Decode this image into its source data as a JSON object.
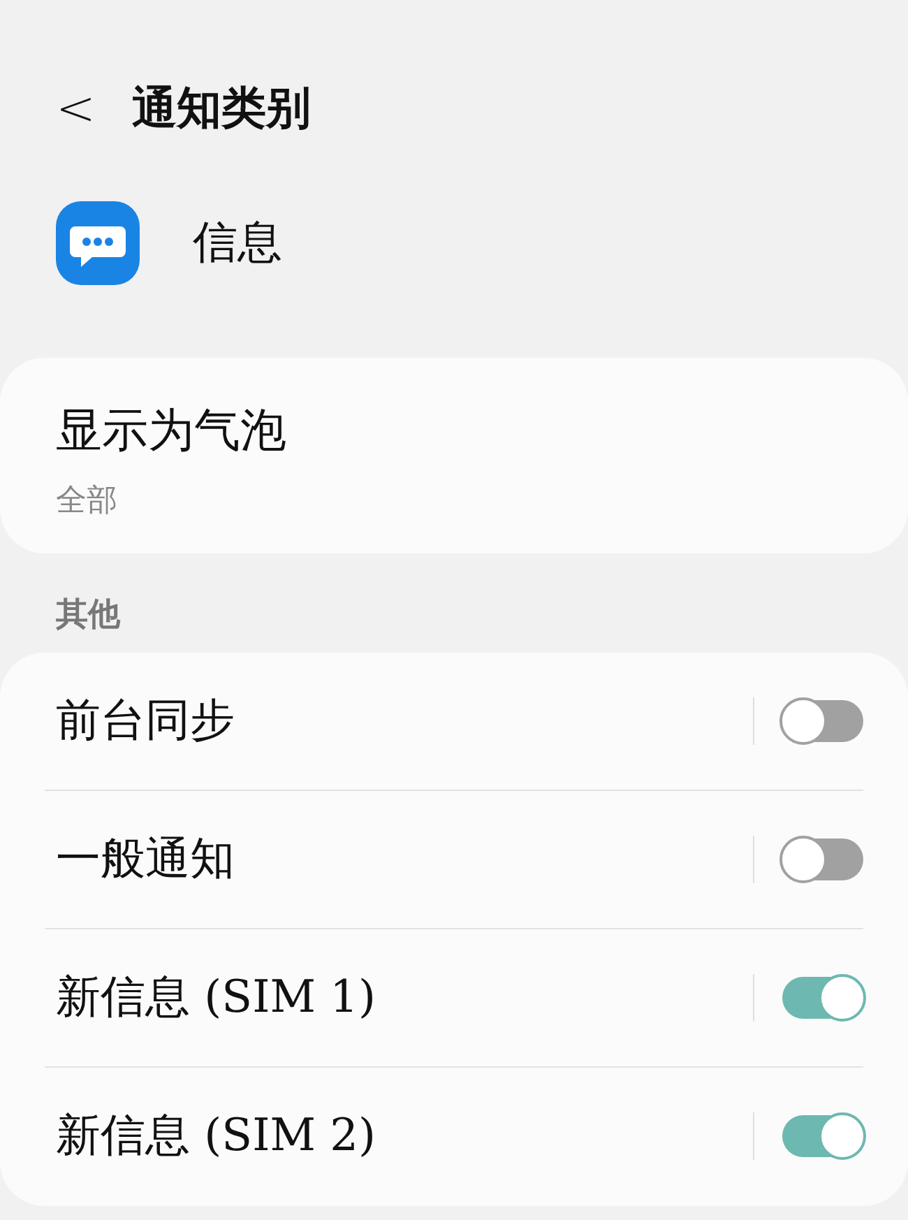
{
  "header": {
    "back": "<",
    "title": "通知类别"
  },
  "app": {
    "name": "信息"
  },
  "bubble": {
    "title": "显示为气泡",
    "value": "全部"
  },
  "section": {
    "title": "其他"
  },
  "rows": [
    {
      "label": "前台同步",
      "on": false
    },
    {
      "label": "一般通知",
      "on": false
    },
    {
      "label": "新信息 (SIM 1)",
      "on": true
    },
    {
      "label": "新信息 (SIM 2)",
      "on": true
    }
  ]
}
